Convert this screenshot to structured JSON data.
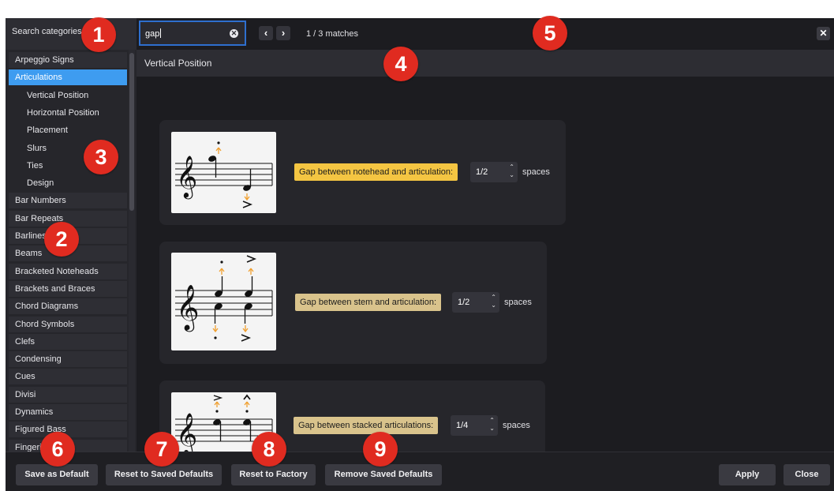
{
  "search": {
    "categories_placeholder": "Search categories",
    "query": "gap"
  },
  "nav": {
    "prev": "‹",
    "next": "›",
    "matches": "1 / 3 matches",
    "close": "✕",
    "clear": "✕"
  },
  "sidebar": {
    "items": [
      {
        "label": "Arpeggio Signs",
        "level": 0
      },
      {
        "label": "Articulations",
        "level": 0,
        "selected": true
      },
      {
        "label": "Vertical Position",
        "level": 1
      },
      {
        "label": "Horizontal Position",
        "level": 1
      },
      {
        "label": "Placement",
        "level": 1
      },
      {
        "label": "Slurs",
        "level": 1
      },
      {
        "label": "Ties",
        "level": 1
      },
      {
        "label": "Design",
        "level": 1
      },
      {
        "label": "Bar Numbers",
        "level": 0
      },
      {
        "label": "Bar Repeats",
        "level": 0
      },
      {
        "label": "Barlines",
        "level": 0
      },
      {
        "label": "Beams",
        "level": 0
      },
      {
        "label": "Bracketed Noteheads",
        "level": 0
      },
      {
        "label": "Brackets and Braces",
        "level": 0
      },
      {
        "label": "Chord Diagrams",
        "level": 0
      },
      {
        "label": "Chord Symbols",
        "level": 0
      },
      {
        "label": "Clefs",
        "level": 0
      },
      {
        "label": "Condensing",
        "level": 0
      },
      {
        "label": "Cues",
        "level": 0
      },
      {
        "label": "Divisi",
        "level": 0
      },
      {
        "label": "Dynamics",
        "level": 0
      },
      {
        "label": "Figured Bass",
        "level": 0
      },
      {
        "label": "Fingering",
        "level": 0
      }
    ]
  },
  "section": {
    "title": "Vertical Position"
  },
  "options": [
    {
      "label": "Gap between notehead and articulation:",
      "value": "1/2",
      "units": "spaces",
      "highlight": "active"
    },
    {
      "label": "Gap between stem and articulation:",
      "value": "1/2",
      "units": "spaces",
      "highlight": "match"
    },
    {
      "label": "Gap between stacked articulations:",
      "value": "1/4",
      "units": "spaces",
      "highlight": "match"
    }
  ],
  "buttons": {
    "save_default": "Save as Default",
    "reset_saved": "Reset to Saved Defaults",
    "reset_factory": "Reset to Factory",
    "remove_saved": "Remove Saved Defaults",
    "apply": "Apply",
    "close": "Close"
  },
  "callouts": [
    "1",
    "2",
    "3",
    "4",
    "5",
    "6",
    "7",
    "8",
    "9"
  ],
  "colors": {
    "accent": "#3e9cf0",
    "highlight_active": "#f4c542",
    "highlight_match": "#d9c38c",
    "callout": "#e02b20",
    "arrow": "#f0a030"
  }
}
